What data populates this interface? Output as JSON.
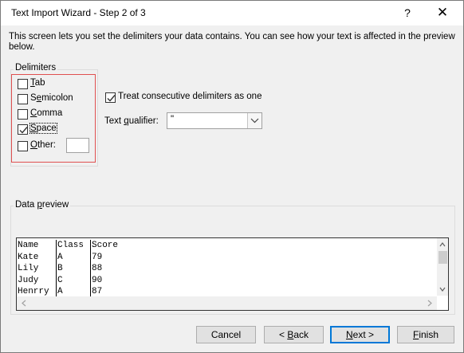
{
  "window": {
    "title": "Text Import Wizard - Step 2 of 3",
    "help_glyph": "?",
    "close_glyph": "✕"
  },
  "intro_text": "This screen lets you set the delimiters your data contains.  You can see how your text is affected in the preview below.",
  "delimiters": {
    "group_title": "Delimiters",
    "items": [
      {
        "pre": "",
        "key": "T",
        "post": "ab",
        "checked": false
      },
      {
        "pre": "S",
        "key": "e",
        "post": "micolon",
        "checked": false
      },
      {
        "pre": "",
        "key": "C",
        "post": "omma",
        "checked": false
      },
      {
        "pre": "",
        "key": "S",
        "post": "pace",
        "checked": true
      },
      {
        "pre": "",
        "key": "O",
        "post": "ther:",
        "checked": false
      }
    ],
    "other_value": ""
  },
  "consecutive": {
    "pre": "",
    "key": "R",
    "post": "Treat consecutive delimiters as one",
    "checked": true
  },
  "qualifier": {
    "label_pre": "Text ",
    "label_key": "q",
    "label_post": "ualifier:",
    "value": "\""
  },
  "preview": {
    "group_title_pre": "Data ",
    "group_title_key": "p",
    "group_title_post": "review",
    "rows": [
      [
        "Name",
        "Class",
        "Score"
      ],
      [
        "Kate",
        "A",
        "79"
      ],
      [
        "Lily",
        "B",
        "88"
      ],
      [
        "Judy",
        "C",
        "90"
      ],
      [
        "Henrry",
        "A",
        "87"
      ]
    ]
  },
  "buttons": {
    "cancel": "Cancel",
    "back_pre": "< ",
    "back_key": "B",
    "back_post": "ack",
    "next_key": "N",
    "next_post": "ext >",
    "finish_key": "F",
    "finish_post": "inish"
  },
  "colors": {
    "accent": "#0078d7",
    "highlight": "#e05050"
  }
}
